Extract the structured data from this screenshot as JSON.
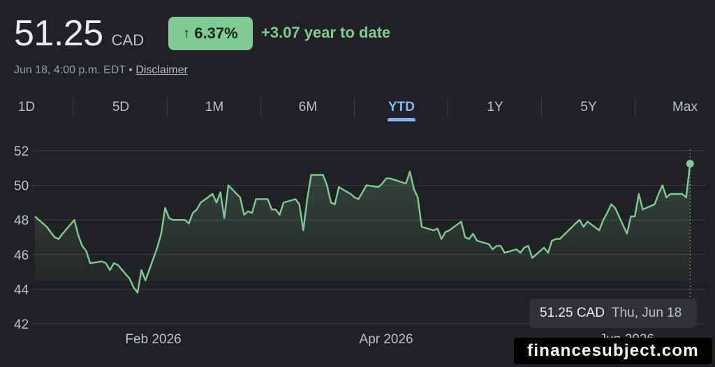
{
  "quote": {
    "price": "51.25",
    "currency": "CAD",
    "change_pct": "6.37%",
    "change_abs": "+3.07 year to date",
    "timestamp": "Jun 18, 4:00 p.m. EDT",
    "separator": "•",
    "disclaimer": "Disclaimer"
  },
  "tabs": [
    {
      "label": "1D"
    },
    {
      "label": "5D"
    },
    {
      "label": "1M"
    },
    {
      "label": "6M"
    },
    {
      "label": "YTD",
      "active": true
    },
    {
      "label": "1Y"
    },
    {
      "label": "5Y"
    },
    {
      "label": "Max"
    }
  ],
  "tooltip": {
    "price": "51.25 CAD",
    "date": "Thu, Jun 18"
  },
  "watermark": "financesubject.com",
  "colors": {
    "line": "#81c995",
    "active_tab": "#8ab4f8",
    "grid": "#3c4043",
    "background": "#202124"
  },
  "chart_data": {
    "type": "area",
    "title": "",
    "xlabel": "",
    "ylabel": "",
    "ylim": [
      42,
      52
    ],
    "yticks": [
      42,
      44,
      46,
      48,
      50,
      52
    ],
    "xtick_labels": [
      "Feb 2026",
      "Apr 2026",
      "Jun 2026"
    ],
    "grid": true,
    "x": [
      "2026-01-02",
      "2026-01-05",
      "2026-01-06",
      "2026-01-07",
      "2026-01-08",
      "2026-01-09",
      "2026-01-12",
      "2026-01-13",
      "2026-01-14",
      "2026-01-15",
      "2026-01-16",
      "2026-01-19",
      "2026-01-20",
      "2026-01-21",
      "2026-01-22",
      "2026-01-23",
      "2026-01-26",
      "2026-01-27",
      "2026-01-28",
      "2026-01-29",
      "2026-01-30",
      "2026-02-02",
      "2026-02-03",
      "2026-02-04",
      "2026-02-05",
      "2026-02-06",
      "2026-02-09",
      "2026-02-10",
      "2026-02-11",
      "2026-02-12",
      "2026-02-13",
      "2026-02-16",
      "2026-02-17",
      "2026-02-18",
      "2026-02-19",
      "2026-02-20",
      "2026-02-23",
      "2026-02-24",
      "2026-02-25",
      "2026-02-26",
      "2026-02-27",
      "2026-03-02",
      "2026-03-03",
      "2026-03-04",
      "2026-03-05",
      "2026-03-06",
      "2026-03-09",
      "2026-03-10",
      "2026-03-11",
      "2026-03-12",
      "2026-03-13",
      "2026-03-16",
      "2026-03-17",
      "2026-03-18",
      "2026-03-19",
      "2026-03-20",
      "2026-03-23",
      "2026-03-24",
      "2026-03-25",
      "2026-03-26",
      "2026-03-27",
      "2026-03-30",
      "2026-03-31",
      "2026-04-01",
      "2026-04-02",
      "2026-04-06",
      "2026-04-07",
      "2026-04-08",
      "2026-04-09",
      "2026-04-10",
      "2026-04-13",
      "2026-04-14",
      "2026-04-15",
      "2026-04-16",
      "2026-04-17",
      "2026-04-20",
      "2026-04-21",
      "2026-04-22",
      "2026-04-23",
      "2026-04-24",
      "2026-04-27",
      "2026-04-28",
      "2026-04-29",
      "2026-04-30",
      "2026-05-01",
      "2026-05-04",
      "2026-05-05",
      "2026-05-06",
      "2026-05-07",
      "2026-05-08",
      "2026-05-11",
      "2026-05-12",
      "2026-05-13",
      "2026-05-14",
      "2026-05-15",
      "2026-05-19",
      "2026-05-20",
      "2026-05-21",
      "2026-05-22",
      "2026-05-25",
      "2026-05-26",
      "2026-05-27",
      "2026-05-28",
      "2026-05-29",
      "2026-06-01",
      "2026-06-02",
      "2026-06-03",
      "2026-06-04",
      "2026-06-05",
      "2026-06-08",
      "2026-06-09",
      "2026-06-10",
      "2026-06-11",
      "2026-06-12",
      "2026-06-15",
      "2026-06-16",
      "2026-06-17",
      "2026-06-18"
    ],
    "series": [
      {
        "values": [
          48.2,
          47.6,
          47.3,
          47.0,
          46.9,
          47.2,
          48.0,
          47.1,
          46.5,
          46.2,
          45.5,
          45.6,
          45.5,
          45.1,
          45.5,
          45.4,
          44.6,
          44.1,
          43.8,
          45.1,
          44.5,
          46.4,
          47.2,
          48.7,
          48.1,
          48.0,
          48.0,
          47.8,
          48.4,
          48.6,
          49.0,
          49.5,
          49.0,
          49.6,
          48.1,
          50.0,
          49.3,
          48.3,
          48.5,
          48.4,
          49.2,
          49.2,
          48.6,
          48.6,
          48.3,
          49.0,
          49.2,
          48.9,
          47.4,
          49.2,
          50.6,
          50.6,
          50.0,
          49.0,
          48.9,
          49.9,
          49.5,
          49.3,
          49.2,
          49.6,
          50.0,
          49.9,
          50.1,
          50.4,
          50.4,
          50.1,
          50.8,
          49.8,
          49.3,
          47.6,
          47.4,
          47.5,
          46.9,
          47.3,
          47.4,
          47.9,
          47.0,
          46.9,
          47.2,
          46.8,
          46.6,
          46.3,
          46.5,
          46.5,
          46.1,
          46.3,
          46.1,
          46.4,
          46.5,
          45.8,
          46.4,
          46.1,
          46.8,
          46.9,
          46.9,
          47.8,
          48.0,
          47.6,
          47.9,
          47.4,
          48.0,
          48.4,
          48.9,
          48.7,
          47.2,
          48.2,
          48.2,
          49.5,
          48.6,
          48.9,
          49.5,
          50.0,
          49.3,
          49.5,
          49.5,
          49.3,
          51.25
        ]
      }
    ]
  }
}
